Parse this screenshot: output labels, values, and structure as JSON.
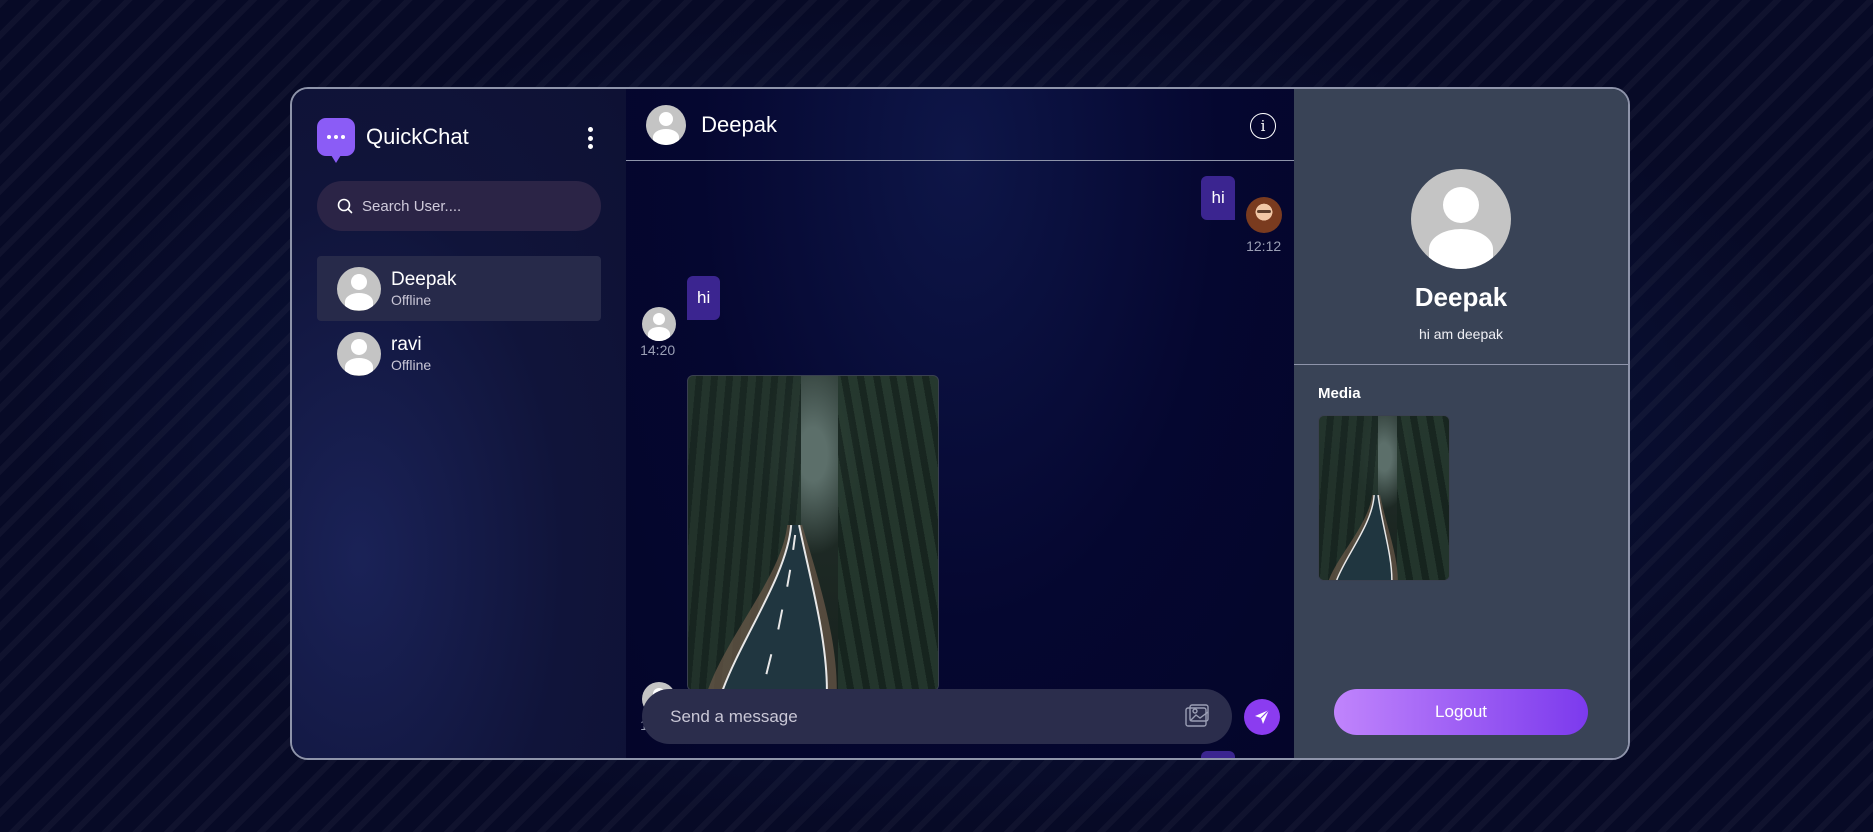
{
  "app": {
    "name": "QuickChat"
  },
  "search": {
    "placeholder": "Search User...."
  },
  "users": [
    {
      "name": "Deepak",
      "status": "Offline",
      "active": true
    },
    {
      "name": "ravi",
      "status": "Offline",
      "active": false
    }
  ],
  "chat": {
    "contact_name": "Deepak",
    "info_icon": "info-icon",
    "messages": [
      {
        "type": "text",
        "direction": "sent",
        "text": "hi",
        "time": "12:12"
      },
      {
        "type": "text",
        "direction": "received",
        "text": "hi",
        "time": "14:20"
      },
      {
        "type": "image",
        "direction": "received",
        "alt": "forest road photo",
        "time": "14:2"
      }
    ],
    "composer_placeholder": "Send a message",
    "gallery_icon": "gallery-icon",
    "send_icon": "send-icon"
  },
  "profile": {
    "name": "Deepak",
    "bio": "hi am deepak",
    "media_label": "Media",
    "logout_label": "Logout"
  },
  "colors": {
    "accent": "#8b5cf6",
    "bubble": "#3b2590",
    "right_panel": "#394356",
    "search_bg": "#2b2446"
  }
}
